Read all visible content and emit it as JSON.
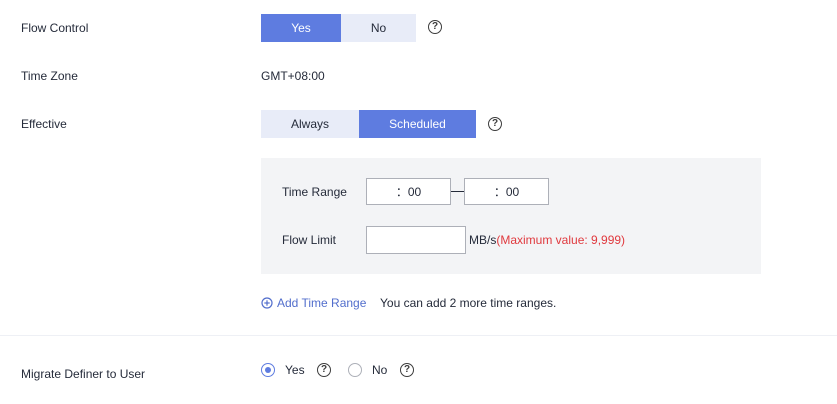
{
  "flow_control": {
    "label": "Flow Control",
    "options": [
      "Yes",
      "No"
    ],
    "selected": "Yes"
  },
  "time_zone": {
    "label": "Time Zone",
    "value": "GMT+08:00"
  },
  "effective": {
    "label": "Effective",
    "options": [
      "Always",
      "Scheduled"
    ],
    "selected": "Scheduled"
  },
  "schedule": {
    "time_range_label": "Time Range",
    "start_time": "：00",
    "end_time": "：00",
    "flow_limit_label": "Flow Limit",
    "flow_limit_value": "",
    "unit": "MB/s",
    "max_hint": "(Maximum value: 9,999)"
  },
  "add_time_range": {
    "icon": "plus-circle-icon",
    "label": "Add Time Range",
    "note": "You can add 2 more time ranges."
  },
  "migrate_definer": {
    "label": "Migrate Definer to User",
    "options": [
      "Yes",
      "No"
    ],
    "selected": "Yes"
  },
  "colors": {
    "accent": "#5e7ce0",
    "warning": "#e0393e",
    "link": "#526ecc"
  }
}
